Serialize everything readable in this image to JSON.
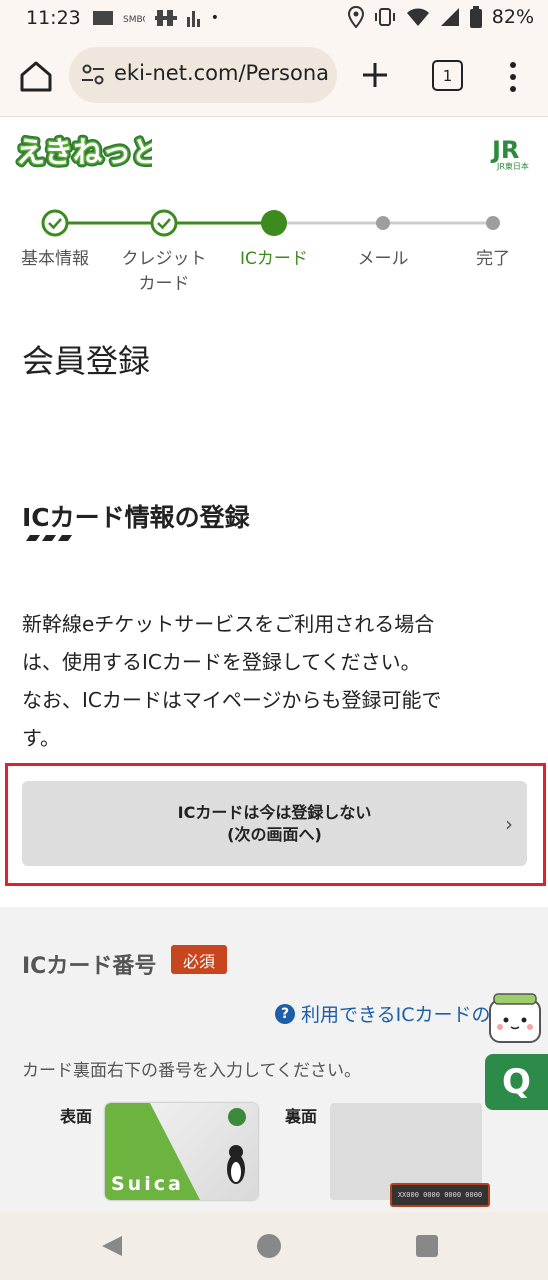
{
  "status_bar": {
    "time": "11:23",
    "battery": "82%"
  },
  "browser": {
    "url": "eki-net.com/Persona",
    "tab_count": "1"
  },
  "site": {
    "logo_text": "えきねっと",
    "jr_logo": "JR東日本"
  },
  "steps": [
    {
      "label": "基本情報",
      "state": "done"
    },
    {
      "label": "クレジット\nカード",
      "state": "done"
    },
    {
      "label": "ICカード",
      "state": "current"
    },
    {
      "label": "メール",
      "state": "todo"
    },
    {
      "label": "完了",
      "state": "todo"
    }
  ],
  "page": {
    "title": "会員登録",
    "section_title": "ICカード情報の登録",
    "description": [
      "新幹線eチケットサービスをご利用される場合",
      "は、使用するICカードを登録してください。",
      "なお、ICカードはマイページからも登録可能で",
      "す。"
    ],
    "skip_button": {
      "line1": "ICカードは今は登録しない",
      "line2": "(次の画面へ)"
    }
  },
  "form": {
    "field_label": "ICカード番号",
    "required_badge": "必須",
    "help_link": "利用できるICカードの",
    "hint": "カード裏面右下の番号を入力してください。",
    "front_label": "表面",
    "back_label": "裏面",
    "card_brand": "Suica",
    "card_number_sample": "XX000 0000 0000 0000"
  },
  "chat_button": "Q",
  "colors": {
    "accent_green": "#3d8a1e",
    "highlight_red": "#e0212e",
    "badge": "#c8461d",
    "link": "#1c5fa8"
  }
}
